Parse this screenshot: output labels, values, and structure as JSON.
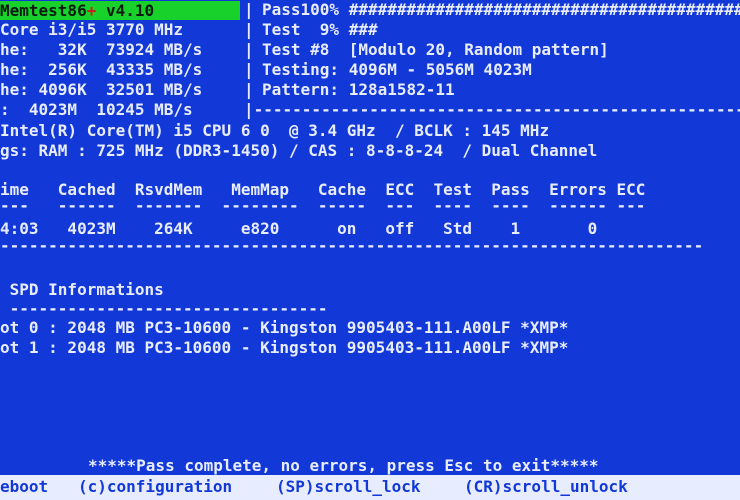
{
  "header": {
    "app_name": "Memtest86",
    "plus": "+",
    "version": " v4.10",
    "cpu_line": "Core i3/i5 3770 MHz",
    "l1_line": "he:   32K  73924 MB/s",
    "l2_line": "he:  256K  43335 MB/s",
    "l3_line": "he: 4096K  32501 MB/s",
    "mem_line": ":  4023M  10245 MB/s"
  },
  "right": {
    "pass_line": "Pass100% ################################################",
    "test_line": "Test  9% ###",
    "test_no_line": "Test #8  [Modulo 20, Random pattern]",
    "testing_line": "Testing: 4096M - 5056M 4023M",
    "pattern_line": "Pattern: 128a1582-11",
    "sep_bar": "|",
    "divider_line": "|----------------------------------------------------------"
  },
  "system": {
    "cpu_info": "Intel(R) Core(TM) i5 CPU 6 0  @ 3.4 GHz  / BCLK : 145 MHz",
    "ram_info": "gs: RAM : 725 MHz (DDR3-1450) / CAS : 8-8-8-24  / Dual Channel"
  },
  "table": {
    "header": "ime   Cached  RsvdMem   MemMap   Cache  ECC  Test  Pass  Errors ECC",
    "dashes": "---   ------  -------  --------  -----  ---  ----  ----  ------ ---",
    "row": "4:03   4023M    264K     e820      on   off   Std    1       0",
    "rule": "-------------------------------------------------------------------------"
  },
  "spd": {
    "title": " SPD Informations",
    "underline": " ---------------------------------",
    "slot0": "ot 0 : 2048 MB PC3-10600 - Kingston 9905403-111.A00LF *XMP*",
    "slot1": "ot 1 : 2048 MB PC3-10600 - Kingston 9905403-111.A00LF *XMP*"
  },
  "status": {
    "message": "*****Pass complete, no errors, press Esc to exit*****"
  },
  "footer": {
    "reboot": "eboot",
    "config": "(c)configuration",
    "scroll_lock": "(SP)scroll_lock",
    "scroll_unlock": "(CR)scroll_unlock"
  },
  "colors": {
    "background": "#1239d8",
    "title_highlight": "#18d12a",
    "text": "#e8ecff"
  }
}
